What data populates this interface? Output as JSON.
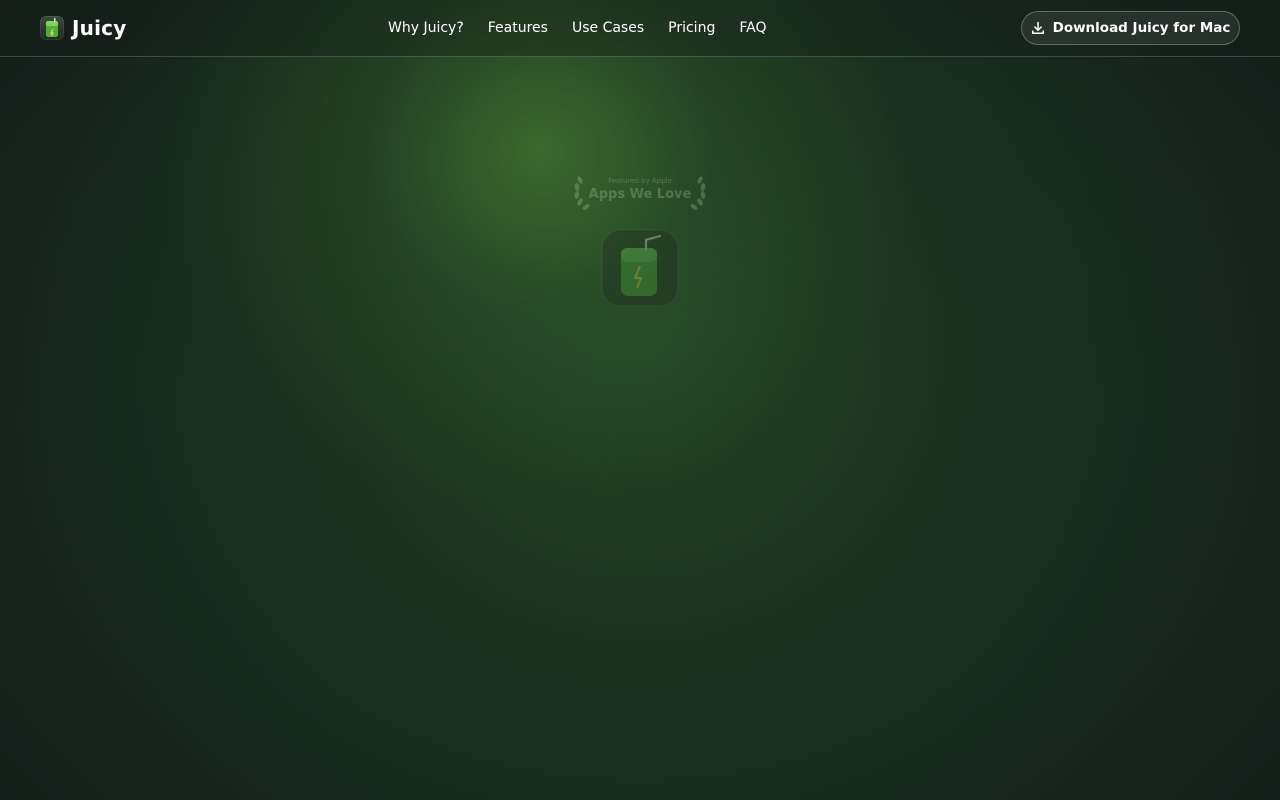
{
  "brand": {
    "name": "Juicy",
    "logo_icon": "juice-box-icon",
    "accent": "#6ed04a"
  },
  "nav": {
    "items": [
      {
        "label": "Why Juicy?"
      },
      {
        "label": "Features"
      },
      {
        "label": "Use Cases"
      },
      {
        "label": "Pricing"
      },
      {
        "label": "FAQ"
      }
    ]
  },
  "header": {
    "download_label": "Download Juicy for Mac",
    "download_icon": "download-icon"
  },
  "hero": {
    "award_small": "Featured by Apple",
    "award_big": "Apps We Love",
    "app_icon": "juicy-app-icon"
  },
  "colors": {
    "background": "#17221c",
    "glow": "#3a6a30",
    "text": "#ffffff"
  }
}
